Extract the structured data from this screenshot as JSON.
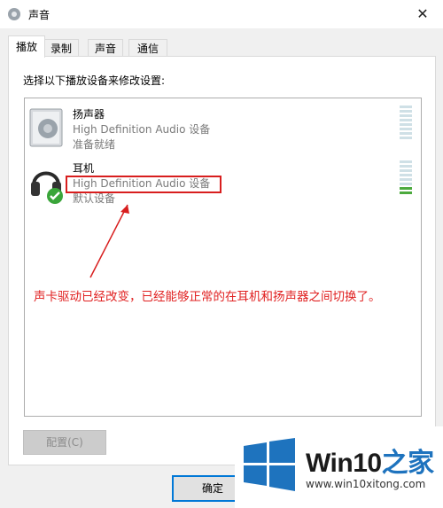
{
  "window": {
    "title": "声音",
    "close_label": "✕"
  },
  "tabs": [
    {
      "label": "播放",
      "active": true
    },
    {
      "label": "录制",
      "active": false
    },
    {
      "label": "声音",
      "active": false
    },
    {
      "label": "通信",
      "active": false
    }
  ],
  "instruction": "选择以下播放设备来修改设置:",
  "devices": [
    {
      "name": "扬声器",
      "driver": "High Definition Audio 设备",
      "status": "准备就绪",
      "icon": "speaker-icon",
      "level": 0
    },
    {
      "name": "耳机",
      "driver": "High Definition Audio 设备",
      "status": "默认设备",
      "icon": "headphones-icon",
      "level": 0.2,
      "default": true
    }
  ],
  "annotation": "声卡驱动已经改变，已经能够正常的在耳机和扬声器之间切换了。",
  "buttons": {
    "configure": "配置(C)",
    "ok": "确定"
  },
  "watermark": {
    "brand_left": "Win10",
    "brand_right": "之家",
    "url": "www.win10xitong.com"
  },
  "colors": {
    "annotation_red": "#d81e1e",
    "brand_blue": "#1e73be",
    "meter_green": "#4caa3e"
  }
}
